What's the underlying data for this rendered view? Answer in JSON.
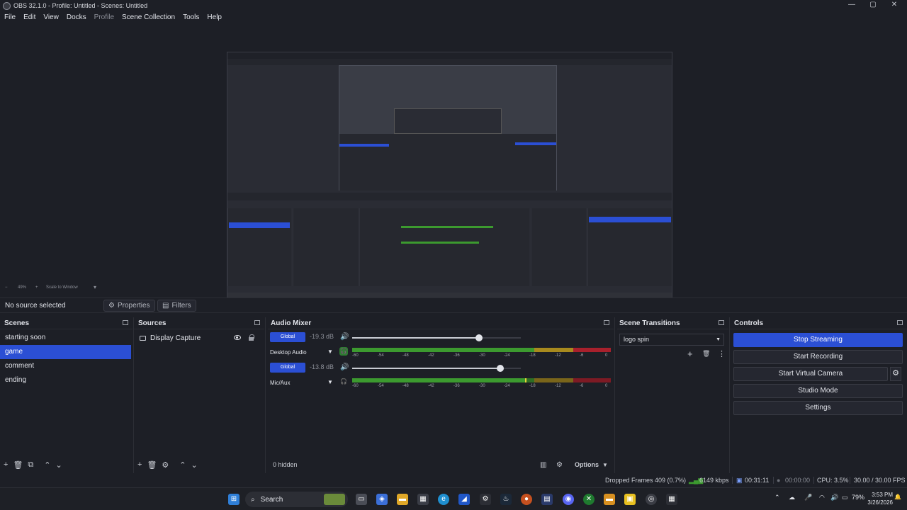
{
  "window": {
    "title": "OBS 32.1.0 - Profile: Untitled - Scenes: Untitled",
    "min": "—",
    "max": "▢",
    "close": "✕"
  },
  "menu": [
    "File",
    "Edit",
    "View",
    "Docks",
    "Profile",
    "Scene Collection",
    "Tools",
    "Help"
  ],
  "preview": {
    "zoom_minus": "−",
    "zoom": "49%",
    "zoom_plus": "+",
    "scale_mode": "Scale to Window"
  },
  "context": {
    "no_source": "No source selected",
    "properties": "Properties",
    "filters": "Filters"
  },
  "scenes": {
    "title": "Scenes",
    "items": [
      "starting soon",
      "game",
      "comment",
      "ending"
    ],
    "selected": "game"
  },
  "sources": {
    "title": "Sources",
    "items": [
      {
        "name": "Display Capture"
      }
    ]
  },
  "mixer": {
    "title": "Audio Mixer",
    "channels": [
      {
        "chip": "Global",
        "db": "-19.3 dB",
        "name": "Desktop Audio",
        "volume_pct": 75
      },
      {
        "chip": "Global",
        "db": "-13.8 dB",
        "name": "Mic/Aux",
        "volume_pct": 88
      }
    ],
    "ticks": [
      "-60",
      "-54",
      "-48",
      "-42",
      "-36",
      "-30",
      "-24",
      "-18",
      "-12",
      "-6",
      "0"
    ],
    "hidden": "0 hidden",
    "options": "Options"
  },
  "transitions": {
    "title": "Scene Transitions",
    "selected": "logo spin"
  },
  "controls": {
    "title": "Controls",
    "stop_streaming": "Stop Streaming",
    "start_recording": "Start Recording",
    "start_virtual_camera": "Start Virtual Camera",
    "studio_mode": "Studio Mode",
    "settings": "Settings"
  },
  "status": {
    "dropped": "Dropped Frames 409 (0.7%)",
    "kbps": "6149 kbps",
    "stream_time": "00:31:11",
    "rec_time": "00:00:00",
    "cpu": "CPU: 3.5%",
    "fps": "30.00 / 30.00 FPS"
  },
  "taskbar": {
    "search": "Search",
    "battery": "79%",
    "time": "3:53 PM",
    "date": "3/26/2026"
  },
  "colors": {
    "accent": "#2b4fd4",
    "meter_green": "#3c9a2f",
    "meter_yellow": "#a88a1e",
    "meter_red": "#a8202c"
  }
}
